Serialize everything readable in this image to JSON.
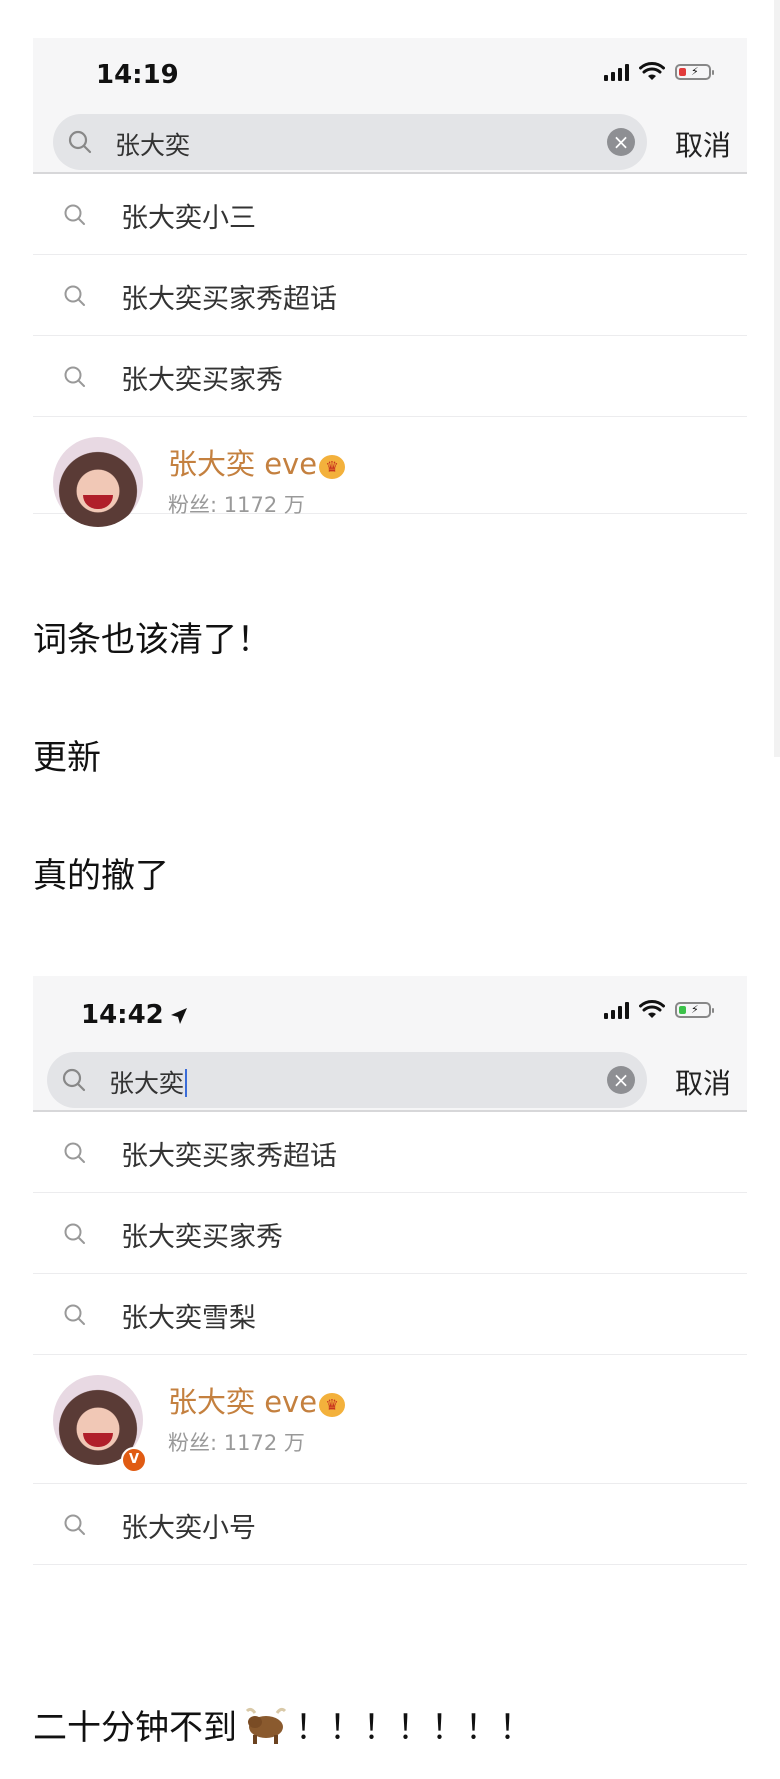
{
  "screenshot1": {
    "time": "14:19",
    "search_query": "张大奕",
    "cancel_label": "取消",
    "suggestions": [
      {
        "label": "张大奕小三"
      },
      {
        "label": "张大奕买家秀超话"
      },
      {
        "label": "张大奕买家秀"
      }
    ],
    "user": {
      "name": "张大奕 eve",
      "fans": "粉丝: 1172 万"
    },
    "battery_color": "#e23b3b"
  },
  "caption1": "词条也该清了！",
  "caption2": "更新",
  "caption3": "真的撤了",
  "screenshot2": {
    "time": "14:42",
    "search_query": "张大奕",
    "cancel_label": "取消",
    "suggestions_top": [
      {
        "label": "张大奕买家秀超话"
      },
      {
        "label": "张大奕买家秀"
      },
      {
        "label": "张大奕雪梨"
      }
    ],
    "user": {
      "name": "张大奕 eve",
      "fans": "粉丝: 1172 万",
      "verified_badge": "V"
    },
    "suggestions_bottom": [
      {
        "label": "张大奕小号"
      }
    ],
    "battery_color": "#3cc24a"
  },
  "caption4_text": "二十分钟不到",
  "caption4_tail": "！！！！！！！",
  "icons": {
    "search": "search-icon",
    "clear": "clear-icon",
    "crown": "crown-icon",
    "ox": "ox-emoji",
    "location": "location-arrow-icon"
  }
}
